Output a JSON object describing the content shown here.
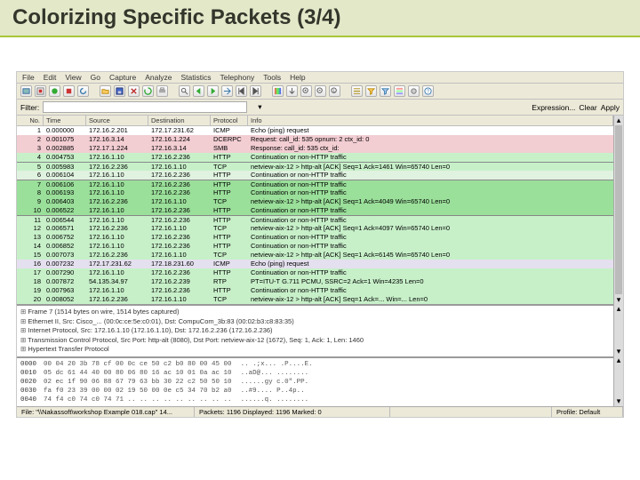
{
  "slide": {
    "title": "Colorizing Specific Packets (3/4)"
  },
  "menu": {
    "items": [
      "File",
      "Edit",
      "View",
      "Go",
      "Capture",
      "Analyze",
      "Statistics",
      "Telephony",
      "Tools",
      "Help"
    ]
  },
  "filter": {
    "label": "Filter:",
    "actions": [
      "Expression...",
      "Clear",
      "Apply"
    ]
  },
  "columns": {
    "no": "No.",
    "time": "Time",
    "src": "Source",
    "dst": "Destination",
    "proto": "Protocol",
    "info": "Info"
  },
  "packets": [
    {
      "no": "1",
      "time": "0.000000",
      "src": "172.16.2.201",
      "dst": "172.17.231.62",
      "proto": "ICMP",
      "info": "Echo (ping) request",
      "cls": "bg-white"
    },
    {
      "no": "2",
      "time": "0.001075",
      "src": "172.16.3.14",
      "dst": "172.16.1.224",
      "proto": "DCERPC",
      "info": "Request: call_id: 535 opnum: 2 ctx_id: 0",
      "cls": "bg-pink"
    },
    {
      "no": "3",
      "time": "0.002885",
      "src": "172.17.1.224",
      "dst": "172.16.3.14",
      "proto": "SMB",
      "info": "Response: call_id: 535 ctx_id:",
      "cls": "bg-pink"
    },
    {
      "no": "4",
      "time": "0.004753",
      "src": "172.16.1.10",
      "dst": "172.16.2.236",
      "proto": "HTTP",
      "info": "Continuation or non-HTTP traffic",
      "cls": "bg-http"
    },
    {
      "no": "5",
      "time": "0.005983",
      "src": "172.16.2.236",
      "dst": "172.16.1.10",
      "proto": "TCP",
      "info": "netview-aix-12 > http-alt [ACK] Seq=1 Ack=1461 Win=65740 Len=0",
      "cls": "bg-http toprule"
    },
    {
      "no": "6",
      "time": "0.006104",
      "src": "172.16.1.10",
      "dst": "172.16.2.236",
      "proto": "HTTP",
      "info": "Continuation or non-HTTP traffic",
      "cls": "bg-tcp"
    },
    {
      "no": "7",
      "time": "0.006106",
      "src": "172.16.1.10",
      "dst": "172.16.2.236",
      "proto": "HTTP",
      "info": "Continuation or non-HTTP traffic",
      "cls": "bg-httpdk toprule"
    },
    {
      "no": "8",
      "time": "0.006193",
      "src": "172.16.1.10",
      "dst": "172.16.2.236",
      "proto": "HTTP",
      "info": "Continuation or non-HTTP traffic",
      "cls": "bg-httpdk"
    },
    {
      "no": "9",
      "time": "0.006403",
      "src": "172.16.2.236",
      "dst": "172.16.1.10",
      "proto": "TCP",
      "info": "netview-aix-12 > http-alt [ACK] Seq=1 Ack=4049 Win=65740 Len=0",
      "cls": "bg-httpdk"
    },
    {
      "no": "10",
      "time": "0.006522",
      "src": "172.16.1.10",
      "dst": "172.16.2.236",
      "proto": "HTTP",
      "info": "Continuation or non-HTTP traffic",
      "cls": "bg-httpdk"
    },
    {
      "no": "11",
      "time": "0.006544",
      "src": "172.16.1.10",
      "dst": "172.16.2.236",
      "proto": "HTTP",
      "info": "Continuation or non-HTTP traffic",
      "cls": "bg-http toprule"
    },
    {
      "no": "12",
      "time": "0.006571",
      "src": "172.16.2.236",
      "dst": "172.16.1.10",
      "proto": "TCP",
      "info": "netview-aix-12 > http-alt [ACK] Seq=1 Ack=4097 Win=65740 Len=0",
      "cls": "bg-http"
    },
    {
      "no": "13",
      "time": "0.006752",
      "src": "172.16.1.10",
      "dst": "172.16.2.236",
      "proto": "HTTP",
      "info": "Continuation or non-HTTP traffic",
      "cls": "bg-http"
    },
    {
      "no": "14",
      "time": "0.006852",
      "src": "172.16.1.10",
      "dst": "172.16.2.236",
      "proto": "HTTP",
      "info": "Continuation or non-HTTP traffic",
      "cls": "bg-http"
    },
    {
      "no": "15",
      "time": "0.007073",
      "src": "172.16.2.236",
      "dst": "172.16.1.10",
      "proto": "TCP",
      "info": "netview-aix-12 > http-alt [ACK] Seq=1 Ack=6145 Win=65740 Len=0",
      "cls": "bg-http"
    },
    {
      "no": "16",
      "time": "0.007232",
      "src": "172.17.231.62",
      "dst": "172.18.231.60",
      "proto": "ICMP",
      "info": "Echo (ping) request",
      "cls": "bg-icmp"
    },
    {
      "no": "17",
      "time": "0.007290",
      "src": "172.16.1.10",
      "dst": "172.16.2.236",
      "proto": "HTTP",
      "info": "Continuation or non-HTTP traffic",
      "cls": "bg-http"
    },
    {
      "no": "18",
      "time": "0.007872",
      "src": "54.135.34.97",
      "dst": "172.16.2.239",
      "proto": "RTP",
      "info": "PT=ITU-T G.711 PCMU, SSRC=2 Ack=1 Win=4235 Len=0",
      "cls": "bg-http"
    },
    {
      "no": "19",
      "time": "0.007963",
      "src": "172.16.1.10",
      "dst": "172.16.2.236",
      "proto": "HTTP",
      "info": "Continuation or non-HTTP traffic",
      "cls": "bg-http"
    },
    {
      "no": "20",
      "time": "0.008052",
      "src": "172.16.2.236",
      "dst": "172.16.1.10",
      "proto": "TCP",
      "info": "netview-aix-12 > http-alt [ACK] Seq=1 Ack=... Win=... Len=0",
      "cls": "bg-http"
    }
  ],
  "details": {
    "l0": "Frame 7 (1514 bytes on wire, 1514 bytes captured)",
    "l1": "Ethernet II, Src: Cisco_... (00:0c:ce:5e:c0:01), Dst: CompuCom_3b:83 (00:02:b3:c8:83:35)",
    "l2": "Internet Protocol, Src: 172.16.1.10 (172.16.1.10), Dst: 172.16.2.236 (172.16.2.236)",
    "l3": "Transmission Control Protocol, Src Port: http-alt (8080), Dst Port: netview-aix-12 (1672), Seq: 1, Ack: 1, Len: 1460",
    "l4": "Hypertext Transfer Protocol"
  },
  "hex": {
    "off": [
      "0000",
      "0010",
      "0020",
      "0030",
      "0040"
    ],
    "bytes": [
      "00 04 20 3b 78 cf 00 0c  ce 50 c2 b0 80 00 45 00",
      "05 dc 61 44 40 00 80 06  80 16 ac 10 01 0a ac 10",
      "02 ec 1f 90 06 88 67 79  63 bb 30 22 c2 50 50 10",
      "fa f0 23 39 00 00 02 19  50 00 0e c5 34 70 b2 a0",
      "74 f4 c0 74 c0 74 71 ..  .. .. .. .. .. .. .. .."
    ],
    "ascii": [
      ".. .;x... .P....E.",
      "..aD@... ........",
      "......gy c.0\".PP.",
      "..#9.... P..4p..",
      "......q. ........"
    ]
  },
  "status": {
    "file": "File: \"\\\\Nakassoft\\workshop Example 018.cap\" 14...",
    "packets": "Packets: 1196 Displayed: 1196 Marked: 0",
    "profile": "Profile: Default"
  }
}
